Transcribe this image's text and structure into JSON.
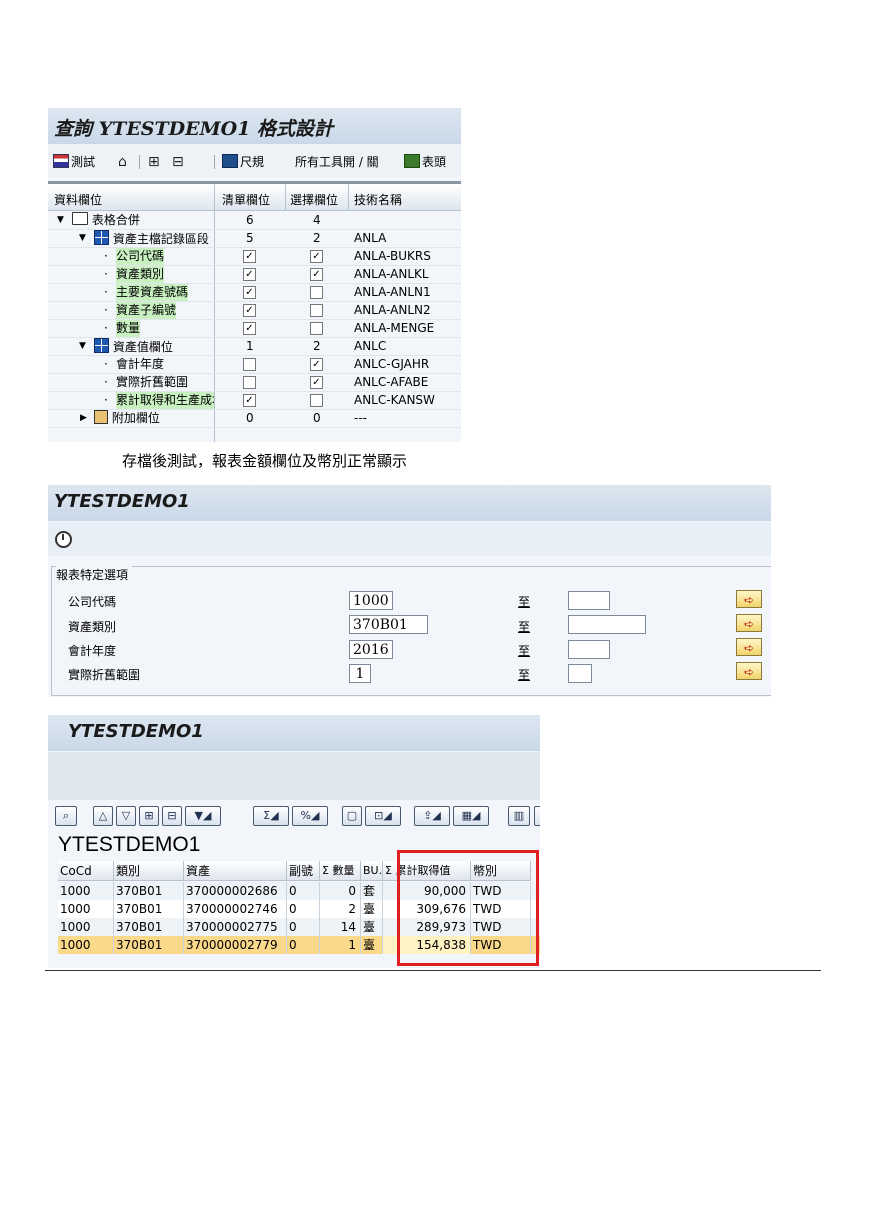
{
  "panel1": {
    "title": "查詢 YTESTDEMO1 格式設計",
    "toolbar": {
      "test_label": "測試",
      "ruler_label": "尺規",
      "all_tools_label": "所有工具開 / 關",
      "header_label": "表頭"
    },
    "columns": [
      "資料欄位",
      "清單欄位",
      "選擇欄位",
      "技術名稱"
    ],
    "rows": [
      {
        "label": "表格合併",
        "list": "6",
        "select": "4",
        "tech": ""
      },
      {
        "label": "資產主檔記錄區段",
        "list": "5",
        "select": "2",
        "tech": "ANLA"
      },
      {
        "label": "公司代碼",
        "list_checked": true,
        "select_checked": true,
        "tech": "ANLA-BUKRS"
      },
      {
        "label": "資產類別",
        "list_checked": true,
        "select_checked": true,
        "tech": "ANLA-ANLKL"
      },
      {
        "label": "主要資產號碼",
        "list_checked": true,
        "select_checked": false,
        "tech": "ANLA-ANLN1"
      },
      {
        "label": "資產子編號",
        "list_checked": true,
        "select_checked": false,
        "tech": "ANLA-ANLN2"
      },
      {
        "label": "數量",
        "list_checked": true,
        "select_checked": false,
        "tech": "ANLA-MENGE"
      },
      {
        "label": "資產值欄位",
        "list": "1",
        "select": "2",
        "tech": "ANLC"
      },
      {
        "label": "會計年度",
        "list_checked": false,
        "select_checked": true,
        "tech": "ANLC-GJAHR"
      },
      {
        "label": "實際折舊範圍",
        "list_checked": false,
        "select_checked": true,
        "tech": "ANLC-AFABE"
      },
      {
        "label": "累計取得和生產成本",
        "list_checked": true,
        "select_checked": false,
        "tech": "ANLC-KANSW"
      },
      {
        "label": "附加欄位",
        "list": "0",
        "select": "0",
        "tech": "---"
      }
    ],
    "check_mark": "✓"
  },
  "caption": "存檔後測試，報表金額欄位及幣別正常顯示",
  "panel2": {
    "title": "YTESTDEMO1",
    "frame_title": "報表特定選項",
    "to_label": "至",
    "arrow": "➪",
    "fields": [
      {
        "label": "公司代碼",
        "value": "1000"
      },
      {
        "label": "資產類別",
        "value": "370B01"
      },
      {
        "label": "會計年度",
        "value": "2016"
      },
      {
        "label": "實際折舊範圍",
        "value": "1"
      }
    ]
  },
  "panel3": {
    "title": "YTESTDEMO1",
    "report_title": "YTESTDEMO1",
    "columns": [
      "CoCd",
      "類別",
      "資產",
      "副號",
      "Σ 數量",
      "BU..",
      "Σ 累計取得值",
      "幣別"
    ],
    "rows": [
      [
        "1000",
        "370B01",
        "370000002686",
        "0",
        "0",
        "套",
        "90,000",
        "TWD"
      ],
      [
        "1000",
        "370B01",
        "370000002746",
        "0",
        "2",
        "臺",
        "309,676",
        "TWD"
      ],
      [
        "1000",
        "370B01",
        "370000002775",
        "0",
        "14",
        "臺",
        "289,973",
        "TWD"
      ],
      [
        "1000",
        "370B01",
        "370000002779",
        "0",
        "1",
        "臺",
        "154,838",
        "TWD"
      ]
    ],
    "selected_row": 3
  },
  "colors": {
    "highlight_green": "#c8f0c0",
    "selected_row": "#fbd98a",
    "red_box": "#e02020"
  }
}
